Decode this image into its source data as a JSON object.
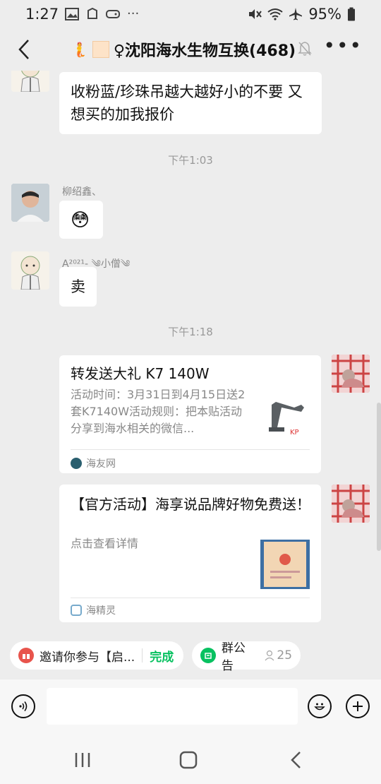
{
  "status_bar": {
    "time": "1:27",
    "battery": "95%"
  },
  "header": {
    "title": "♀沈阳海水生物互换(468)"
  },
  "messages": [
    {
      "text": "收粉蓝/珍珠吊越大越好小的不要 又想买的加我报价"
    },
    {
      "timestamp": "下午1:03"
    },
    {
      "sender": "柳绍鑫、",
      "text": "😳"
    },
    {
      "sender": "A²⁰²¹- ༄小僧༄",
      "text": "卖"
    },
    {
      "timestamp": "下午1:18"
    }
  ],
  "cards": [
    {
      "title": "转发送大礼 K7 140W",
      "desc": "活动时间：3月31日到4月15日送2套K7140W活动规则：把本贴活动分享到海水相关的微信...",
      "source": "海友网"
    },
    {
      "title": "【官方活动】海享说品牌好物免费送！",
      "desc": "点击查看详情",
      "source": "海精灵"
    }
  ],
  "pinned": {
    "invite_text": "邀请你参与【启...",
    "done_label": "完成",
    "notice_label": "群公告",
    "member_count": "25"
  },
  "colors": {
    "accent_green": "#07c160",
    "background": "#ededed"
  }
}
